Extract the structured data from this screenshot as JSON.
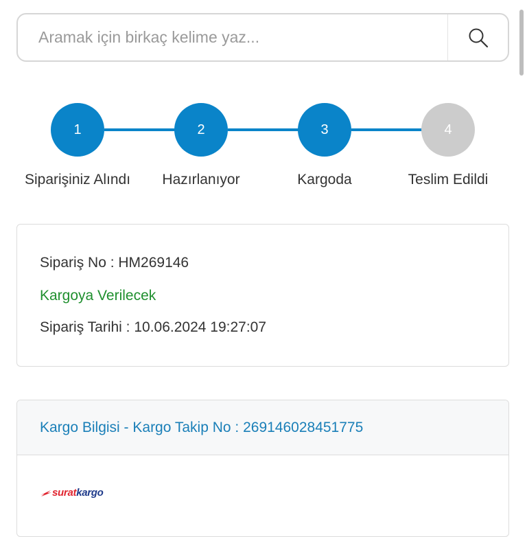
{
  "search": {
    "placeholder": "Aramak için birkaç kelime yaz..."
  },
  "colors": {
    "active": "#0a84c9",
    "inactive": "#cccccc",
    "status_green": "#1f8f2e",
    "link_blue": "#1a7fb8",
    "logo_red": "#e0242f",
    "logo_blue": "#1e3a8a"
  },
  "steps": [
    {
      "number": "1",
      "label": "Siparişiniz Alındı",
      "active": true
    },
    {
      "number": "2",
      "label": "Hazırlanıyor",
      "active": true
    },
    {
      "number": "3",
      "label": "Kargoda",
      "active": true
    },
    {
      "number": "4",
      "label": "Teslim Edildi",
      "active": false
    }
  ],
  "order": {
    "number_line": "Sipariş No : HM269146",
    "status": "Kargoya Verilecek",
    "date_line": "Sipariş Tarihi : 10.06.2024 19:27:07"
  },
  "cargo": {
    "header": "Kargo Bilgisi - Kargo Takip No : 269146028451775",
    "logo": {
      "part1": "surat",
      "part2": "kargo"
    }
  }
}
